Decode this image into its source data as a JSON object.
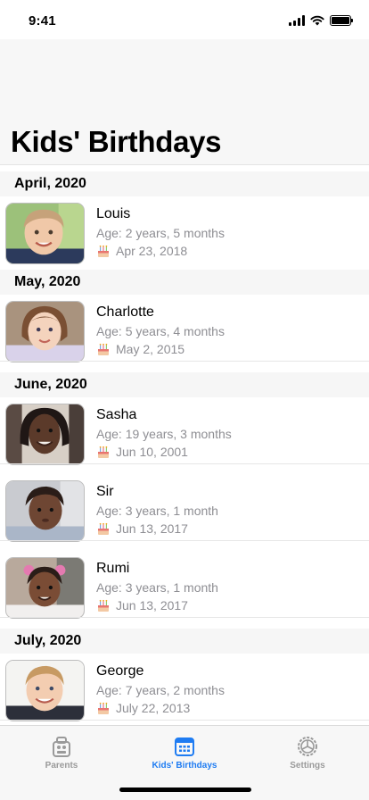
{
  "status_bar": {
    "time": "9:41"
  },
  "title": "Kids' Birthdays",
  "sections": [
    {
      "header": "April, 2020",
      "rows": [
        {
          "name": "Louis",
          "age": "Age: 2 years, 5 months",
          "date": "Apr 23, 2018"
        }
      ]
    },
    {
      "header": "May, 2020",
      "rows": [
        {
          "name": "Charlotte",
          "age": "Age: 5 years, 4 months",
          "date": "May 2, 2015"
        }
      ]
    },
    {
      "header": "June, 2020",
      "rows": [
        {
          "name": "Sasha",
          "age": "Age: 19 years, 3 months",
          "date": "Jun 10, 2001"
        },
        {
          "name": "Sir",
          "age": "Age: 3 years, 1 month",
          "date": "Jun 13, 2017"
        },
        {
          "name": "Rumi",
          "age": "Age: 3 years, 1 month",
          "date": "Jun 13, 2017"
        }
      ]
    },
    {
      "header": "July, 2020",
      "rows": [
        {
          "name": "George",
          "age": "Age: 7 years, 2 months",
          "date": "July 22, 2013"
        }
      ]
    }
  ],
  "tabs": [
    {
      "label": "Parents",
      "icon": "parents-icon",
      "active": false
    },
    {
      "label": "Kids' Birthdays",
      "icon": "calendar-icon",
      "active": true
    },
    {
      "label": "Settings",
      "icon": "gear-icon",
      "active": false
    }
  ],
  "colors": {
    "accent": "#1f7cf2",
    "secondary_text": "#8e8e93",
    "inactive_tab": "#9a9a9a"
  }
}
